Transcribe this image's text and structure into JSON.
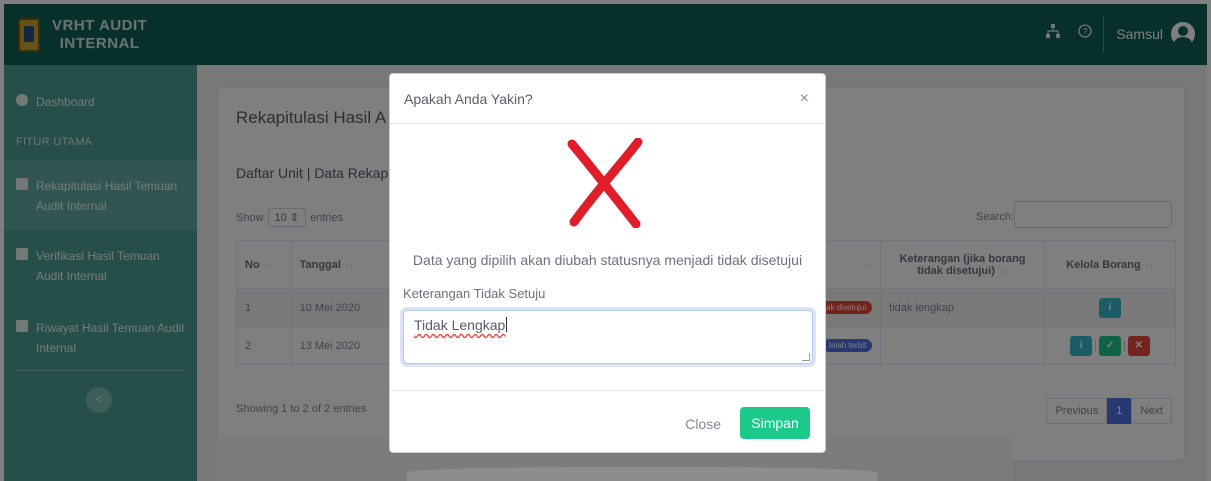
{
  "brand": {
    "line1": "VRHT AUDIT",
    "line2": "INTERNAL"
  },
  "sidebar": {
    "dashboard": "Dashboard",
    "heading": "FITUR UTAMA",
    "items": [
      {
        "label": "Rekapitulasi Hasil Temuan Audit Internal",
        "active": true
      },
      {
        "label": "Verifikasi Hasil Temuan Audit Internal"
      },
      {
        "label": "Riwayat Hasil Temuan Audit Internal"
      }
    ],
    "toggle": "<"
  },
  "topbar": {
    "user_name": "Samsul",
    "icons": [
      "sitemap-icon",
      "question-icon"
    ]
  },
  "page": {
    "title": "Rekapitulasi Hasil A",
    "subtitle": "Daftar Unit | Data Rekap",
    "length_show": "Show",
    "length_value": "10",
    "length_entries": "entries",
    "search_label": "Search:",
    "info": "Showing 1 to 2 of 2 entries",
    "pagination": {
      "prev": "Previous",
      "page": "1",
      "next": "Next"
    }
  },
  "table": {
    "headers": {
      "no": "No",
      "tanggal": "Tanggal",
      "keterangan": "Keterangan (jika borang tidak disetujui)",
      "kelola": "Kelola Borang"
    },
    "rows": [
      {
        "no": "1",
        "tanggal": "10 Mei 2020",
        "status": "tidak disetujui",
        "keterangan": "tidak lengkap"
      },
      {
        "no": "2",
        "tanggal": "13 Mei 2020",
        "status": "telah terbit",
        "keterangan": ""
      }
    ]
  },
  "modal": {
    "title": "Apakah Anda Yakin?",
    "close_x": "×",
    "message": "Data yang dipilih akan diubah statusnya menjadi tidak disetujui",
    "field_label": "Keterangan Tidak Setuju",
    "field_value": "Tidak Lengkap",
    "close_label": "Close",
    "save_label": "Simpan"
  },
  "colors": {
    "primary": "#0e6157",
    "sidebar": "#4f9e93",
    "success": "#1cc88a",
    "danger": "#e74a3b",
    "info": "#36b9cc",
    "cross": "#e01e2a"
  }
}
